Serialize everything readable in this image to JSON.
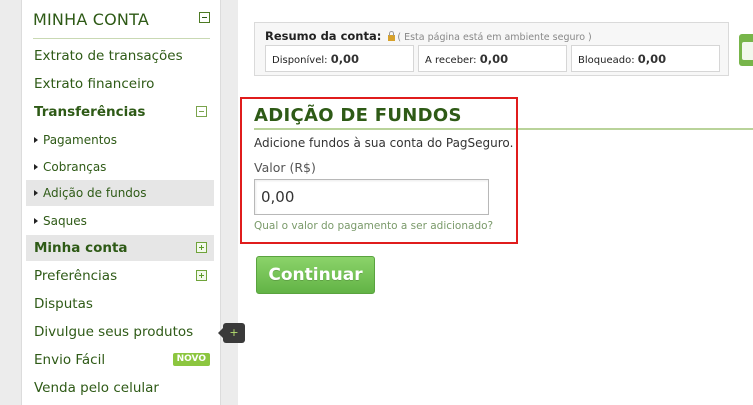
{
  "sidebar": {
    "title": "MINHA CONTA",
    "items": [
      {
        "label": "Extrato de transações"
      },
      {
        "label": "Extrato financeiro"
      },
      {
        "label": "Transferências"
      },
      {
        "label": "Pagamentos"
      },
      {
        "label": "Cobranças"
      },
      {
        "label": "Adição de fundos"
      },
      {
        "label": "Saques"
      },
      {
        "label": "Minha conta"
      },
      {
        "label": "Preferências"
      },
      {
        "label": "Disputas"
      },
      {
        "label": "Divulgue seus produtos"
      },
      {
        "label": "Envio Fácil",
        "badge": "NOVO"
      },
      {
        "label": "Venda pelo celular"
      }
    ],
    "tooltip": "+"
  },
  "summary": {
    "title": "Resumo da conta:",
    "note": "( Esta página está em ambiente seguro )",
    "boxes": [
      {
        "label": "Disponível:",
        "value": "0,00"
      },
      {
        "label": "A receber:",
        "value": "0,00"
      },
      {
        "label": "Bloqueado:",
        "value": "0,00"
      }
    ]
  },
  "main": {
    "title": "ADIÇÃO DE FUNDOS",
    "description": "Adicione fundos à sua conta do PagSeguro.",
    "field_label": "Valor (R$)",
    "field_value": "0,00",
    "field_help": "Qual o valor do pagamento a ser adicionado?",
    "continue_label": "Continuar"
  },
  "colors": {
    "brand_green": "#2e5a16",
    "button_green": "#62b346",
    "highlight_red": "#e01c1c"
  }
}
